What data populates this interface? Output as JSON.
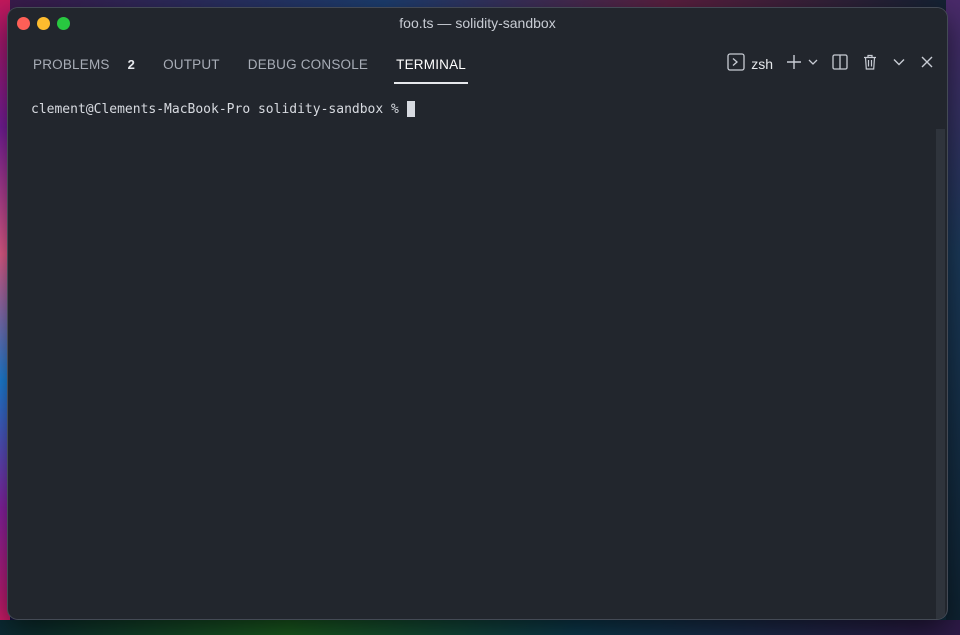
{
  "window": {
    "title": "foo.ts — solidity-sandbox"
  },
  "panel": {
    "tabs": [
      {
        "label": "PROBLEMS",
        "badge": "2"
      },
      {
        "label": "OUTPUT"
      },
      {
        "label": "DEBUG CONSOLE"
      },
      {
        "label": "TERMINAL",
        "active": true
      }
    ],
    "shell": "zsh",
    "icons": [
      "terminal-icon",
      "plus-icon",
      "chevron-down-icon",
      "split-icon",
      "trash-icon",
      "chevron-down-icon",
      "close-icon"
    ]
  },
  "terminal": {
    "prompt": "clement@Clements-MacBook-Pro solidity-sandbox %"
  },
  "colors": {
    "background": "#22262d",
    "close": "#fe5f57",
    "minimize": "#febc2e",
    "maximize": "#28c840"
  }
}
